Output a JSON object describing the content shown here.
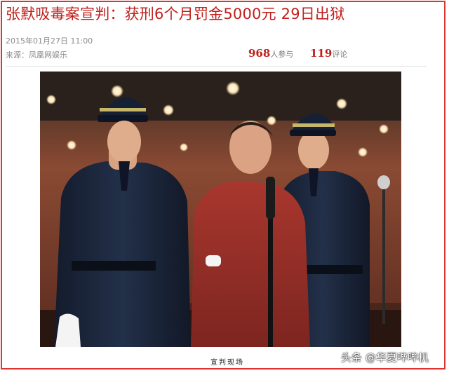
{
  "article": {
    "headline": "张默吸毒案宣判：获刑6个月罚金5000元 29日出狱",
    "date": "2015年01月27日  11:00",
    "source": "来源：凤凰网娱乐",
    "participants": {
      "count": "968",
      "label": "人参与"
    },
    "comments": {
      "count": "119",
      "label": "评论"
    },
    "photo_caption": "宣判现场"
  },
  "watermark": "头条 @华夏哔哔机",
  "photo": {
    "icon": "courtroom-photo"
  },
  "colors": {
    "accent": "#c0201c",
    "frame": "#e0332e"
  }
}
